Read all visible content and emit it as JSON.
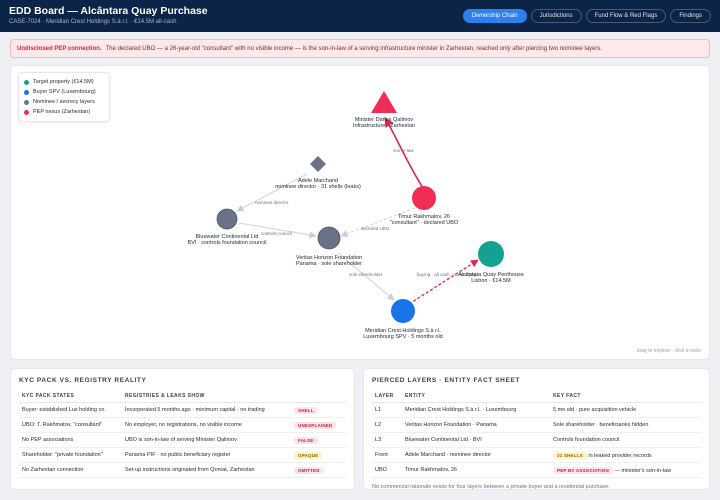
{
  "header": {
    "title": "EDD Board — Alcântara Quay Purchase",
    "subtitle": "CASE-7024 · Meridian Crest Holdings S.à r.l. · €14.5M all-cash",
    "tabs": [
      {
        "label": "Ownership Chain",
        "active": true
      },
      {
        "label": "Jurisdictions",
        "active": false
      },
      {
        "label": "Fund Flow & Red Flags",
        "active": false
      },
      {
        "label": "Findings",
        "active": false
      }
    ]
  },
  "alert": {
    "lead": "Undisclosed PEP connection.",
    "text": "The declared UBO — a 26-year-old \"consultant\" with no visible income — is the son-in-law of a serving infrastructure minister in Zarhestan, reached only after piercing two nominee layers."
  },
  "legend": [
    {
      "label": "Target property (€14.5M)",
      "color": "#11a390"
    },
    {
      "label": "Buyer SPV (Luxembourg)",
      "color": "#1a73e8"
    },
    {
      "label": "Nominee / secrecy layers",
      "color": "#6b7286"
    },
    {
      "label": "PEP nexus (Zarhestan)",
      "color": "#ef2d56"
    }
  ],
  "graph": {
    "nodes": {
      "minister": {
        "line1": "Minister Darius Qalimov",
        "line2": "Infrastructure · Zarhestan"
      },
      "adele": {
        "line1": "Adele Marchand",
        "line2": "nominee director · 31 shells (leaks)"
      },
      "bluewater": {
        "line1": "Bluewater Continental Ltd",
        "line2": "BVI · controls foundation council"
      },
      "timur": {
        "line1": "Timur Rakhmatov, 26",
        "line2": "\"consultant\" · declared UBO"
      },
      "veritas": {
        "line1": "Veritas Horizon Foundation",
        "line2": "Panama · sole shareholder"
      },
      "penthouse": {
        "line1": "Alcântara Quay Penthouse",
        "line2": "Lisbon · €14.5M"
      },
      "meridian": {
        "line1": "Meridian Crest Holdings S.à r.l.",
        "line2": "Luxembourg SPV · 5 months old"
      }
    },
    "edges": {
      "son_in_law": "son-in-law",
      "nominee_director": "nominee director",
      "controls_council": "controls council",
      "declared_ubo": "declared UBO",
      "sole_shareholder": "sole shareholder",
      "buying": "buying · all cash · no mortgage"
    },
    "hint": "drag to explore · click a node"
  },
  "kyc": {
    "title": "KYC PACK VS. REGISTRY REALITY",
    "columns": [
      "KYC PACK STATES",
      "REGISTRIES & LEAKS SHOW",
      ""
    ],
    "rows": [
      {
        "states": "Buyer: established Lux holding co.",
        "shows": "Incorporated 5 months ago · minimum capital · no trading",
        "tag": "SHELL",
        "tone": "red"
      },
      {
        "states": "UBO: T. Rakhmatov, \"consultant\"",
        "shows": "No employer, no registrations, no visible income",
        "tag": "UNEXPLAINED",
        "tone": "red"
      },
      {
        "states": "No PEP associations",
        "shows": "UBO is son-in-law of serving Minister Qalimov",
        "tag": "FALSE",
        "tone": "red"
      },
      {
        "states": "Shareholder: \"private foundation\"",
        "shows": "Panama PIF · no public beneficiary register",
        "tag": "OPAQUE",
        "tone": "yellow"
      },
      {
        "states": "No Zarhestan connection",
        "shows": "Set-up instructions originated from Qorvat, Zarhestan",
        "tag": "OMITTED",
        "tone": "red"
      }
    ]
  },
  "layers": {
    "title": "PIERCED LAYERS · ENTITY FACT SHEET",
    "columns": [
      "LAYER",
      "ENTITY",
      "KEY FACT"
    ],
    "rows": [
      {
        "layer": "L1",
        "entity": "Meridian Crest Holdings S.à r.l. · Luxembourg",
        "pill": "",
        "fact": "5 mo old · pure acquisition vehicle"
      },
      {
        "layer": "L2",
        "entity": "Veritas Horizon Foundation · Panama",
        "pill": "",
        "fact": "Sole shareholder · beneficiaries hidden"
      },
      {
        "layer": "L3",
        "entity": "Bluewater Continental Ltd · BVI",
        "pill": "",
        "fact": "Controls foundation council"
      },
      {
        "layer": "Front",
        "entity": "Adele Marchand · nominee director",
        "pill": "31 SHELLS",
        "pill_tone": "yellow",
        "fact": "in leaked provider records"
      },
      {
        "layer": "UBO",
        "entity": "Timur Rakhmatov, 26",
        "pill": "PEP BY ASSOCIATION",
        "pill_tone": "red",
        "fact": "— minister's son-in-law"
      }
    ],
    "footnote": "No commercial rationale exists for four layers between a private buyer and a residential purchase."
  }
}
